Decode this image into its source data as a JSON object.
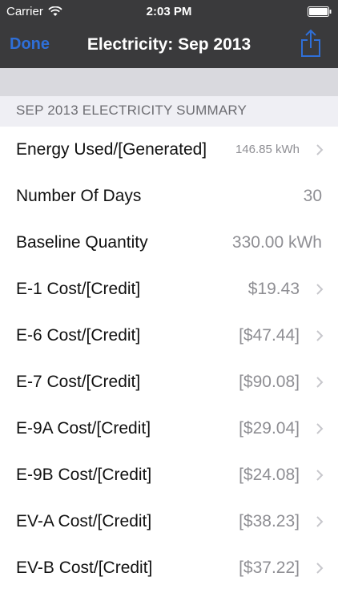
{
  "status_bar": {
    "carrier": "Carrier",
    "time": "2:03 PM"
  },
  "nav": {
    "done_label": "Done",
    "title": "Electricity: Sep 2013"
  },
  "section": {
    "header": "SEP 2013 ELECTRICITY SUMMARY"
  },
  "rows": [
    {
      "label": "Energy Used/[Generated]",
      "value": "146.85 kWh"
    },
    {
      "label": "Number Of Days",
      "value": "30"
    },
    {
      "label": "Baseline Quantity",
      "value": "330.00 kWh"
    },
    {
      "label": "E-1 Cost/[Credit]",
      "value": "$19.43"
    },
    {
      "label": "E-6 Cost/[Credit]",
      "value": "[$47.44]"
    },
    {
      "label": "E-7 Cost/[Credit]",
      "value": "[$90.08]"
    },
    {
      "label": "E-9A Cost/[Credit]",
      "value": "[$29.04]"
    },
    {
      "label": "E-9B Cost/[Credit]",
      "value": "[$24.08]"
    },
    {
      "label": "EV-A Cost/[Credit]",
      "value": "[$38.23]"
    },
    {
      "label": "EV-B Cost/[Credit]",
      "value": "[$37.22]"
    }
  ],
  "colors": {
    "nav_background": "#3a3a3c",
    "accent": "#2f6fd8",
    "section_background": "#efeff4",
    "value_text": "#8e8e93"
  },
  "icons": {
    "status": [
      "wifi-icon",
      "battery-icon"
    ],
    "nav": "share-icon",
    "row": "chevron-right-icon"
  }
}
